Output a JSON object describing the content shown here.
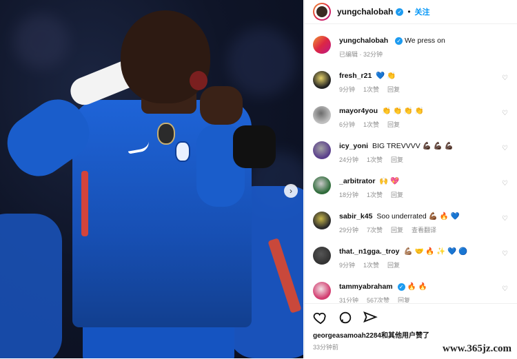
{
  "post": {
    "author": "yungchalobah",
    "follow_label": "关注",
    "caption": "We press on",
    "caption_meta": "已编辑 · 32分钟",
    "likes_text_user": "georgeasamoah2284",
    "likes_text_rest": "和其他用户赞了",
    "time": "33分钟前"
  },
  "comments": [
    {
      "user": "fresh_r21",
      "text": "💙 👏",
      "time": "9分钟",
      "likes": "1次赞",
      "reply": "回复",
      "avatar": "#222",
      "avatar2": "#e5d26a",
      "translate": ""
    },
    {
      "user": "mayor4you",
      "text": "👏 👏 👏 👏",
      "time": "6分钟",
      "likes": "1次赞",
      "reply": "回复",
      "avatar": "#bfbfbf",
      "avatar2": "#6b6b6b",
      "translate": ""
    },
    {
      "user": "icy_yoni",
      "text": "BIG TREVVVV 💪🏿 💪🏿 💪🏿",
      "time": "24分钟",
      "likes": "1次赞",
      "reply": "回复",
      "avatar": "#5a3f8c",
      "avatar2": "#a3a3a3",
      "translate": ""
    },
    {
      "user": "_arbitrator",
      "text": "🙌 💖",
      "time": "18分钟",
      "likes": "1次赞",
      "reply": "回复",
      "avatar": "#2f6b3a",
      "avatar2": "#c9c9c9",
      "translate": ""
    },
    {
      "user": "sabir_k45",
      "text": "Soo underrated 💪🏾 🔥 💙",
      "time": "29分钟",
      "likes": "7次赞",
      "reply": "回复",
      "avatar": "#2a2a2a",
      "avatar2": "#c8b74a",
      "translate": "查看翻译"
    },
    {
      "user": "that._n1gga._troy",
      "text": "💪🏽 🤝 🔥 ✨ 💙 🔵",
      "time": "9分钟",
      "likes": "1次赞",
      "reply": "回复",
      "avatar": "#333333",
      "avatar2": "#555555",
      "translate": ""
    },
    {
      "user": "tammyabraham",
      "text": "🔥 🔥",
      "time": "31分钟",
      "likes": "567次赞",
      "reply": "回复",
      "avatar": "#d23b6f",
      "avatar2": "#f2e2e5",
      "translate": ""
    }
  ],
  "icons": [
    "heart-icon",
    "comment-icon",
    "share-icon"
  ],
  "watermark": "www.365jz.com"
}
